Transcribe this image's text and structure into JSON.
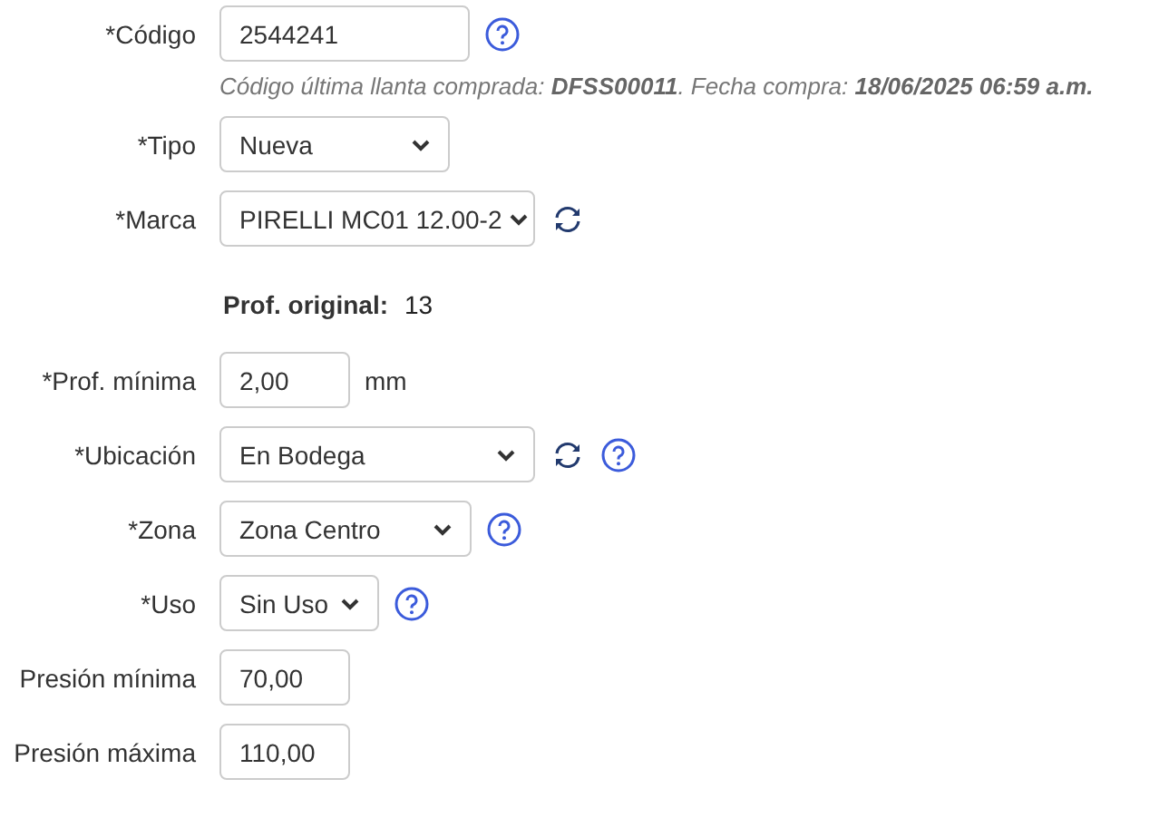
{
  "fields": [
    {
      "kind": "input",
      "label": "*Código",
      "value": "2544241",
      "help": true,
      "refresh": false
    },
    {
      "kind": "hint",
      "text": "Código última llanta comprada: **DFSS00011**. Fecha compra: **18/06/2025 06:59 a.m.**"
    },
    {
      "kind": "select",
      "label": "*Tipo",
      "value": "Nueva",
      "help": false,
      "refresh": false
    },
    {
      "kind": "select",
      "label": "*Marca",
      "value": "PIRELLI MC01 12.00-2",
      "help": false,
      "refresh": true
    },
    {
      "kind": "info",
      "label": "Prof. original:",
      "value": "13"
    },
    {
      "kind": "input",
      "label": "*Prof. mínima",
      "value": "2,00",
      "unit": "mm",
      "help": false,
      "refresh": false
    },
    {
      "kind": "select",
      "label": "*Ubicación",
      "value": "En Bodega",
      "help": true,
      "refresh": true
    },
    {
      "kind": "select",
      "label": "*Zona",
      "value": "Zona Centro",
      "help": true,
      "refresh": false
    },
    {
      "kind": "select",
      "label": "*Uso",
      "value": "Sin Uso",
      "help": true,
      "refresh": false
    },
    {
      "kind": "input",
      "label": "Presión mínima",
      "value": "70,00",
      "help": false,
      "refresh": false
    },
    {
      "kind": "input",
      "label": "Presión máxima",
      "value": "110,00",
      "help": false,
      "refresh": false
    }
  ]
}
